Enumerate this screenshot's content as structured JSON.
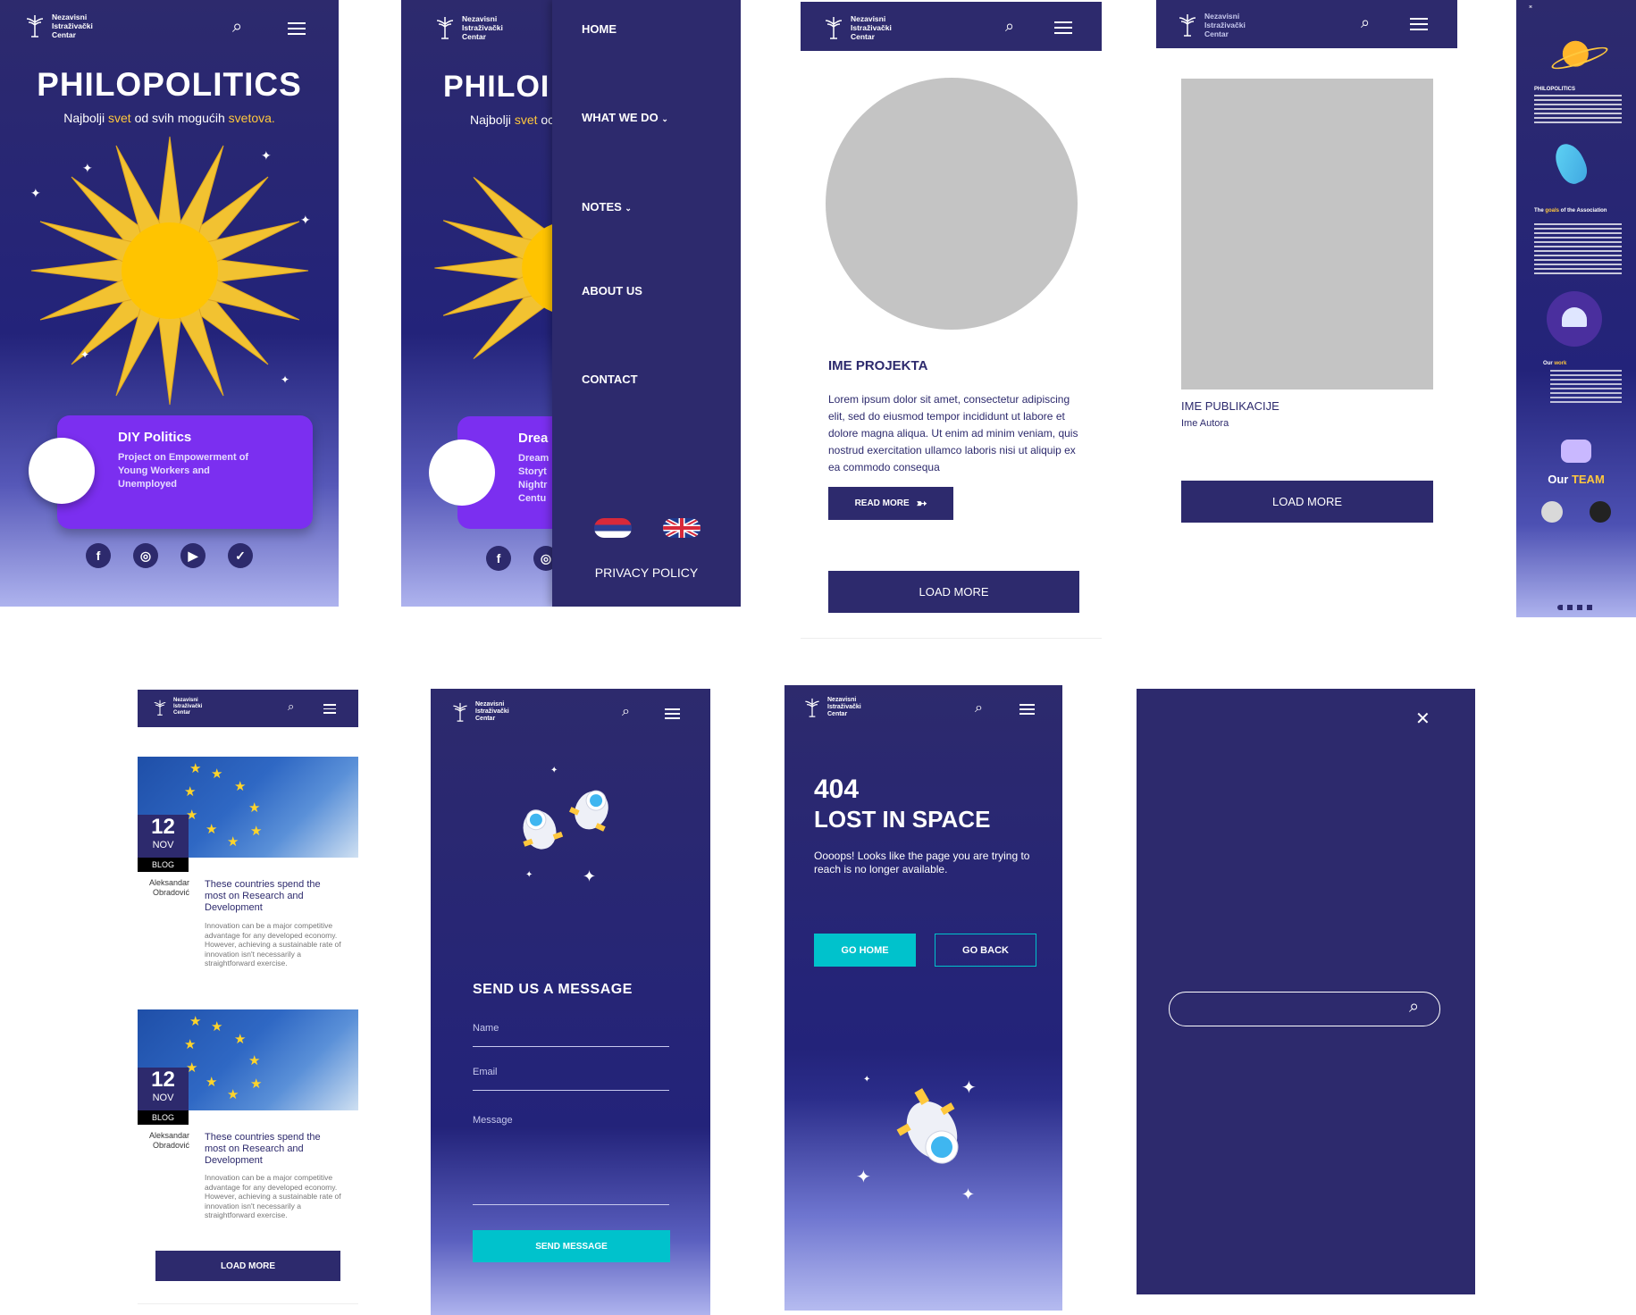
{
  "brand": {
    "logo_text": "Nezavisni\nIstraživački\nCentar"
  },
  "colors": {
    "navy": "#2d2a6d",
    "accent_yellow": "#ffc83d",
    "purple_card": "#7b2ff0",
    "teal": "#00c2cc",
    "placeholder_gray": "#c4c4c4"
  },
  "screen1": {
    "title": "PHILOPOLITICS",
    "tagline": {
      "part1": "Najbolji ",
      "hl1": "svet",
      "part2": " od svih mogućih ",
      "hl2": "svetova."
    },
    "card": {
      "title": "DIY Politics",
      "body": "Project on Empowerment of Young Workers and Unemployed"
    },
    "social": [
      "facebook-icon",
      "instagram-icon",
      "youtube-icon",
      "twitter-icon"
    ]
  },
  "screen2": {
    "title": "PHILOI",
    "tagline": {
      "part1": "Najbolji ",
      "hl1": "svet",
      "part2": " oc"
    },
    "card_partial": {
      "title": "Drea",
      "lines": [
        "Dream",
        "Storyt",
        "Nightr",
        "Centu"
      ]
    },
    "menu": {
      "home": "HOME",
      "what_we_do": "WHAT WE DO",
      "notes": "NOTES",
      "about": "ABOUT US",
      "contact": "CONTACT",
      "privacy": "PRIVACY POLICY"
    }
  },
  "screen3": {
    "project_title": "IME PROJEKTA",
    "body": "Lorem ipsum dolor sit amet, consectetur adipiscing elit, sed do eiusmod tempor incididunt ut labore et dolore magna aliqua. Ut enim ad minim veniam, quis nostrud exercitation ullamco laboris nisi ut aliquip ex ea commodo consequa",
    "read_more": "READ MORE",
    "load_more": "LOAD MORE"
  },
  "screen4": {
    "publication_title": "IME PUBLIKACIJE",
    "author": "Ime Autora",
    "load_more": "LOAD MORE"
  },
  "screen5": {
    "title": "PHILOPOLITICS",
    "goals_pre": "The ",
    "goals_hl": "goals",
    "goals_post": " of the Association",
    "work_pre": "Our ",
    "work_hl": "work",
    "team_pre": "Our ",
    "team_hl": "TEAM"
  },
  "screen6": {
    "posts": [
      {
        "day": "12",
        "month": "NOV",
        "tag": "BLOG",
        "author": "Aleksandar\nObradović",
        "title": "These countries spend the most on Research and Development",
        "excerpt": "Innovation can be a major competitive advantage for any developed economy. However, achieving a sustainable rate of innovation isn't necessarily a straightforward exercise."
      },
      {
        "day": "12",
        "month": "NOV",
        "tag": "BLOG",
        "author": "Aleksandar\nObradović",
        "title": "These countries spend the most on Research and Development",
        "excerpt": "Innovation can be a major competitive advantage for any developed economy. However, achieving a sustainable rate of innovation isn't necessarily a straightforward exercise."
      }
    ],
    "load_more": "LOAD MORE"
  },
  "screen7": {
    "heading": "SEND US A MESSAGE",
    "name_label": "Name",
    "email_label": "Email",
    "message_label": "Message",
    "submit": "SEND MESSAGE"
  },
  "screen8": {
    "code": "404",
    "title": "LOST IN SPACE",
    "message": "Oooops! Looks like the page you are trying to reach is no longer available.",
    "go_home": "GO HOME",
    "go_back": "GO BACK"
  },
  "screen9": {
    "close": "✕",
    "search_placeholder": ""
  }
}
